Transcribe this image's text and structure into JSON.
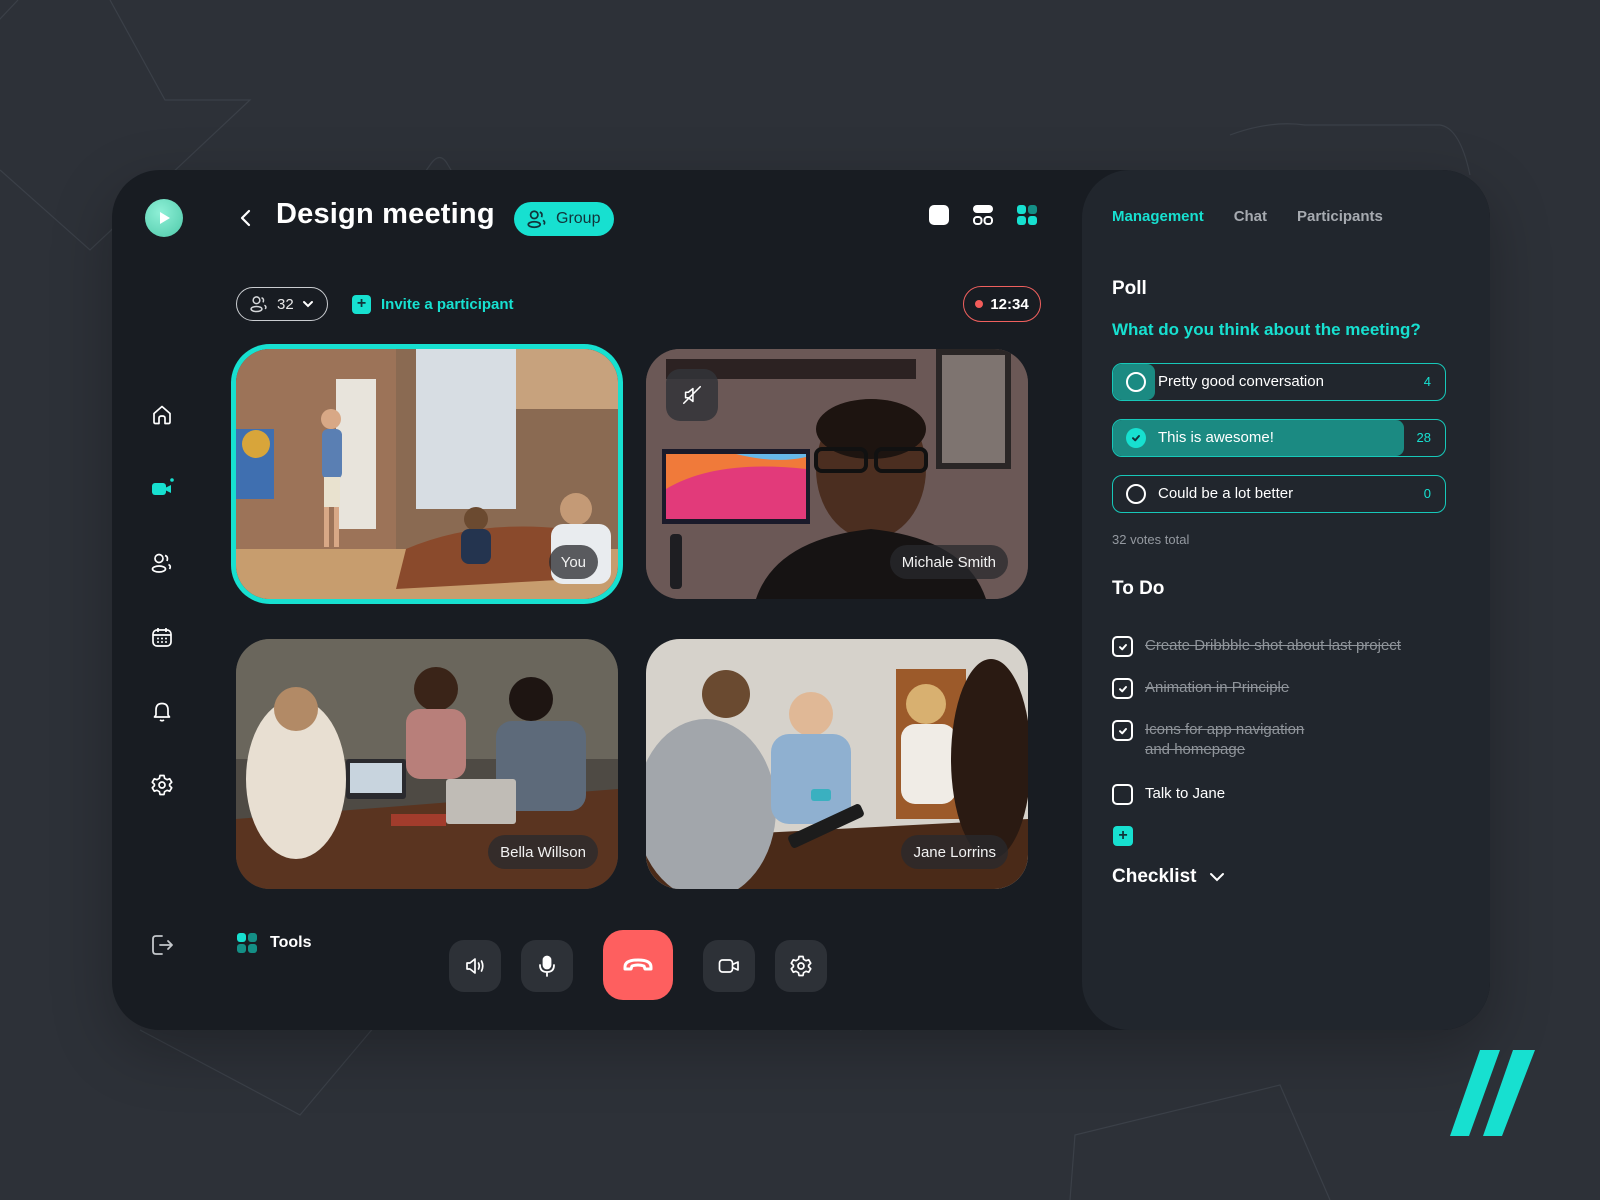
{
  "app": {
    "logo_icon": "play-icon"
  },
  "sidebar": {
    "items": [
      {
        "name": "home",
        "icon": "home-icon",
        "active": false
      },
      {
        "name": "video",
        "icon": "video-camera-icon",
        "active": true,
        "notification": true
      },
      {
        "name": "contacts",
        "icon": "users-icon",
        "active": false
      },
      {
        "name": "calendar",
        "icon": "calendar-icon",
        "active": false
      },
      {
        "name": "notifications",
        "icon": "bell-icon",
        "active": false
      },
      {
        "name": "settings",
        "icon": "gear-icon",
        "active": false
      }
    ],
    "logout_icon": "logout-icon"
  },
  "header": {
    "title": "Design meeting",
    "badge_label": "Group",
    "layouts": [
      "single",
      "split",
      "grid"
    ],
    "active_layout": "grid"
  },
  "toolbar": {
    "participant_count": "32",
    "invite_label": "Invite a participant",
    "recording_time": "12:34"
  },
  "videos": [
    {
      "name": "You",
      "active": true,
      "muted": false
    },
    {
      "name": "Michale Smith",
      "active": false,
      "muted": true
    },
    {
      "name": "Bella Willson",
      "active": false,
      "muted": false
    },
    {
      "name": "Jane Lorrins",
      "active": false,
      "muted": false
    }
  ],
  "controls": {
    "tools_label": "Tools",
    "buttons": [
      "speaker",
      "microphone",
      "hang-up",
      "camera",
      "settings"
    ]
  },
  "panel": {
    "tabs": [
      {
        "label": "Management",
        "active": true
      },
      {
        "label": "Chat",
        "active": false
      },
      {
        "label": "Participants",
        "active": false
      }
    ],
    "poll": {
      "title": "Poll",
      "question": "What do you think about the meeting?",
      "options": [
        {
          "label": "Pretty good conversation",
          "votes": "4",
          "share": 0.125,
          "selected": false
        },
        {
          "label": "This is awesome!",
          "votes": "28",
          "share": 0.875,
          "selected": true
        },
        {
          "label": "Could be a lot better",
          "votes": "0",
          "share": 0,
          "selected": false
        }
      ],
      "total": "32 votes total"
    },
    "todo": {
      "title": "To Do",
      "items": [
        {
          "text": "Create Dribbble shot about last project",
          "done": true
        },
        {
          "text": "Animation in Principle",
          "done": true
        },
        {
          "text": "Icons for app navigation and homepage",
          "done": true
        },
        {
          "text": "Talk to Jane",
          "done": false
        }
      ],
      "add_label": "+"
    },
    "checklist_label": "Checklist"
  },
  "colors": {
    "accent": "#17e0d0",
    "danger": "#fe5f5f",
    "background": "#2d3138",
    "card": "#181c22",
    "panel": "#21262d"
  }
}
